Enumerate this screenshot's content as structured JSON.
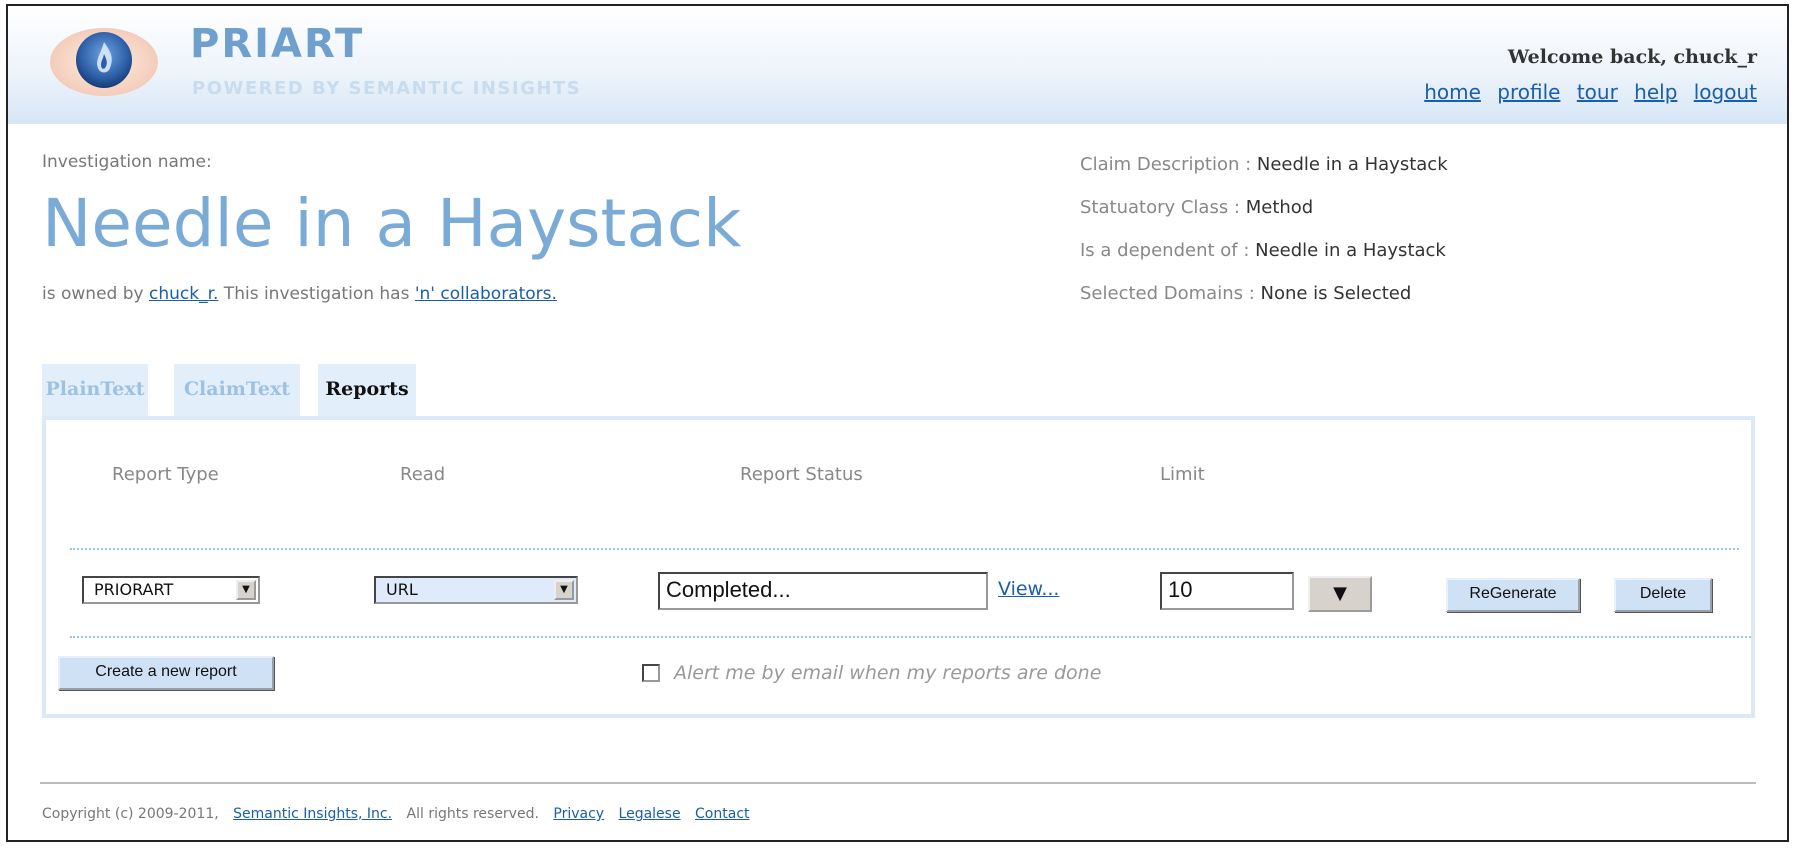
{
  "header": {
    "brand_name": "PRIART",
    "brand_tagline": "POWERED BY SEMANTIC INSIGHTS",
    "welcome": "Welcome back, chuck_r",
    "nav": [
      "home",
      "profile",
      "tour",
      "help",
      "logout"
    ]
  },
  "investigation": {
    "label": "Investigation name:",
    "title": "Needle in a Haystack",
    "owner_prefix": "is owned by ",
    "owner": "chuck_r.",
    "collab_prefix": " This investigation has ",
    "collaborators": "'n' collaborators."
  },
  "claim": [
    {
      "label": "Claim Description : ",
      "value": "Needle in a Haystack"
    },
    {
      "label": "Statuatory Class : ",
      "value": "Method"
    },
    {
      "label": "Is a dependent of : ",
      "value": "Needle in a Haystack"
    },
    {
      "label": "Selected Domains : ",
      "value": "None is Selected"
    }
  ],
  "tabs": [
    "PlainText",
    "ClaimText",
    "Reports"
  ],
  "active_tab": "Reports",
  "reports": {
    "columns": [
      "Report Type",
      "Read",
      "Report Status",
      "Limit"
    ],
    "row": {
      "report_type": "PRIORART",
      "read": "URL",
      "status": "Completed...",
      "view": "View...",
      "limit": "10",
      "regenerate": "ReGenerate",
      "delete": "Delete"
    },
    "create_button": "Create a new report",
    "alert_label": "Alert me by email when my reports are done"
  },
  "footer": {
    "copyright": "Copyright (c) 2009-2011,",
    "company": "Semantic Insights, Inc.",
    "rights": "All rights reserved.",
    "links": [
      "Privacy",
      "Legalese",
      "Contact"
    ]
  },
  "colors": {
    "accent": "#7aaad6",
    "link": "#1a5fa8",
    "tab_bg": "#e2effb",
    "button_bg": "#cfe1f5"
  }
}
